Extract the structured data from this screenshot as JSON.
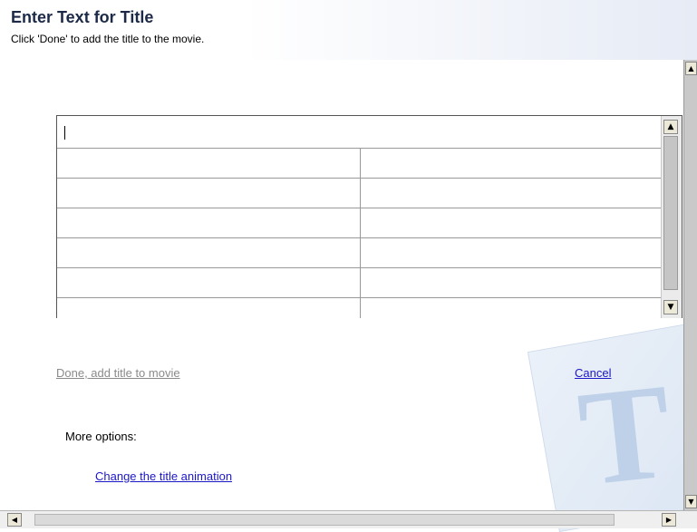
{
  "header": {
    "title": "Enter Text for Title",
    "subtitle": "Click 'Done' to add the title to the movie."
  },
  "editor": {
    "value": "",
    "rows": 6
  },
  "actions": {
    "done_label": "Done, add title to movie",
    "cancel_label": "Cancel"
  },
  "options": {
    "heading": "More options:",
    "change_animation_label": "Change the title animation"
  },
  "watermark": {
    "letter": "T"
  },
  "colors": {
    "link": "#1b17c6",
    "disabled_link": "#8a8a8a",
    "title": "#1c2a48"
  },
  "icons": {
    "scroll_up": "scroll-up-arrow",
    "scroll_down": "scroll-down-arrow",
    "scroll_left": "scroll-left-arrow",
    "scroll_right": "scroll-right-arrow"
  }
}
